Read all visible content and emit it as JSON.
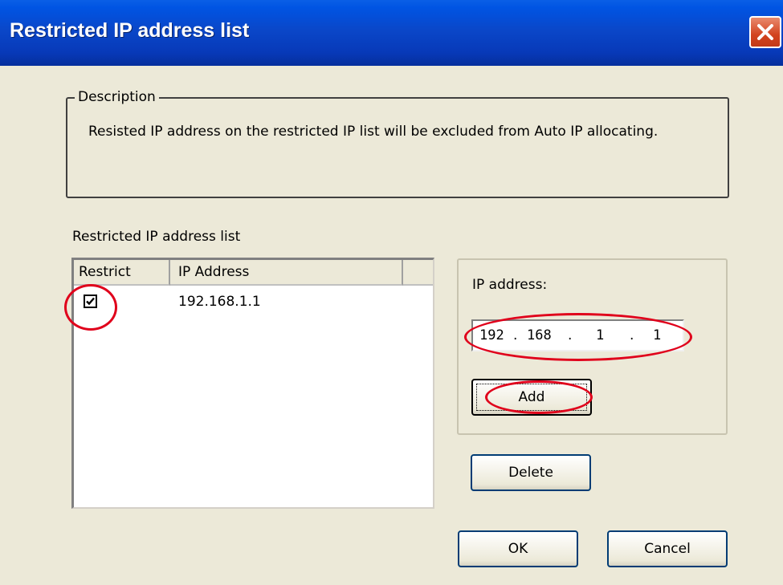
{
  "window": {
    "title": "Restricted IP address list",
    "close_icon": "close-icon"
  },
  "description": {
    "legend": "Description",
    "text": "Resisted IP address on the restricted IP list will be excluded from Auto IP allocating."
  },
  "list": {
    "label": "Restricted IP address list",
    "columns": [
      "Restrict",
      "IP Address",
      ""
    ],
    "rows": [
      {
        "restrict": true,
        "ip": "192.168.1.1"
      }
    ]
  },
  "ip_entry": {
    "label": "IP address:",
    "octets": [
      "192",
      "168",
      "1",
      "1"
    ],
    "separator": "."
  },
  "buttons": {
    "add": "Add",
    "delete": "Delete",
    "ok": "OK",
    "cancel": "Cancel"
  },
  "colors": {
    "titlebar": "#0054e3",
    "annotation": "#e0001b",
    "dialog_bg": "#ece9d8"
  }
}
